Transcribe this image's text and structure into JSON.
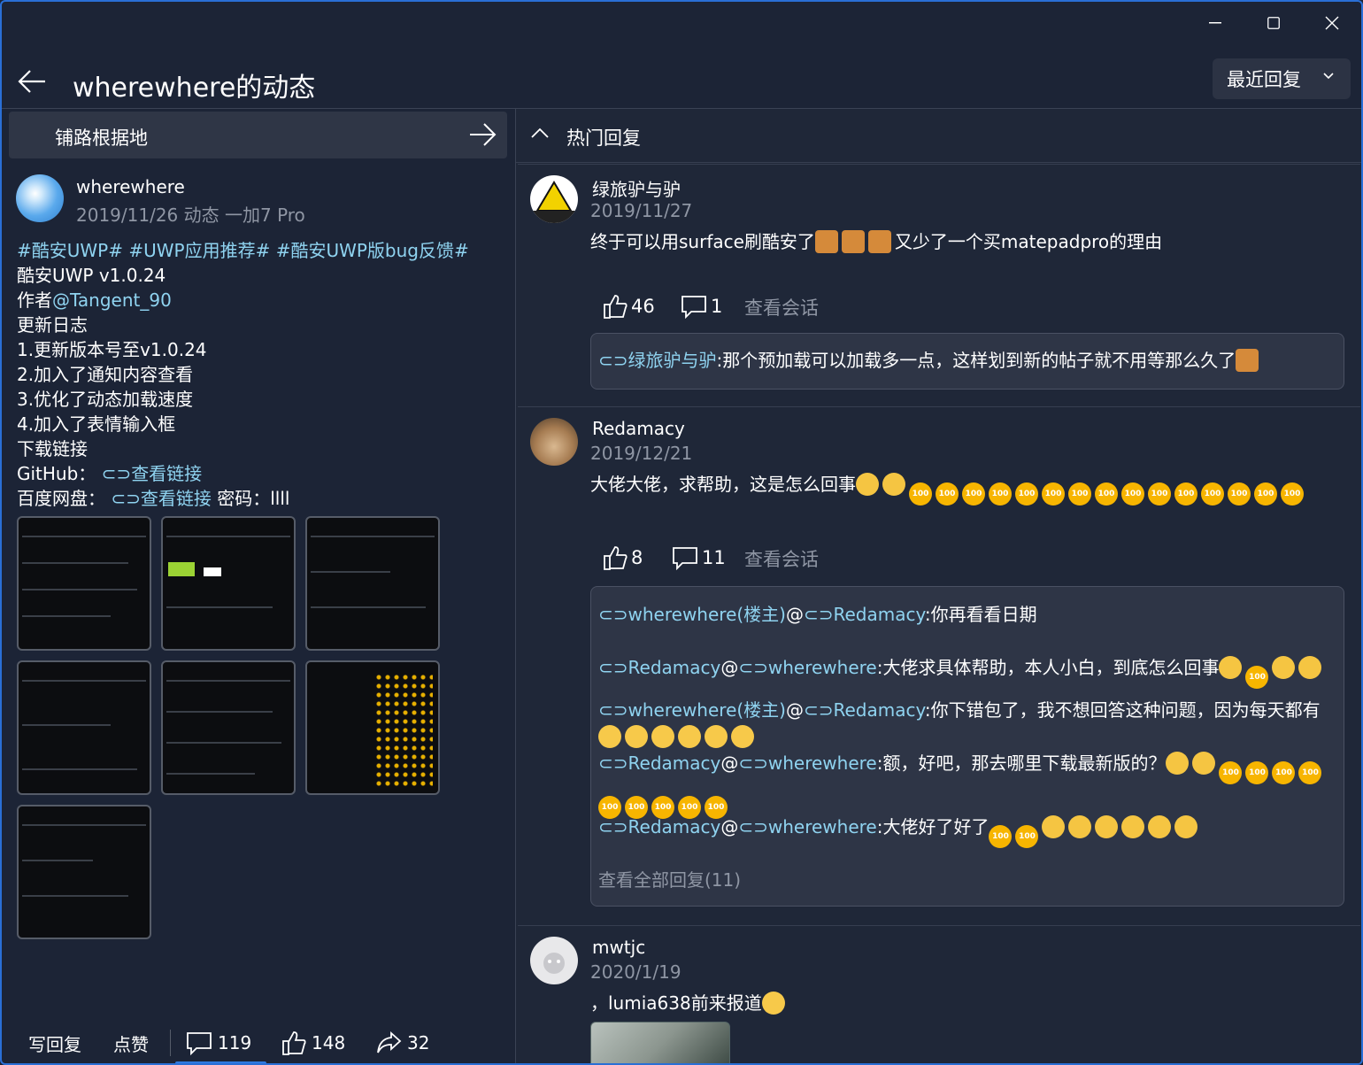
{
  "window": {
    "minimize": "—",
    "maximize": "☐",
    "close": "✕"
  },
  "header": {
    "title": "wherewhere的动态",
    "sort_label": "最近回复"
  },
  "topic": {
    "label": "铺路根据地"
  },
  "post": {
    "author": "wherewhere",
    "meta": "2019/11/26  动态  一加7 Pro",
    "tags": "#酷安UWP# #UWP应用推荐# #酷安UWP版bug反馈#",
    "line1": "酷安UWP v1.0.24",
    "line2_prefix": "作者",
    "line2_mention": "@Tangent_90",
    "line3": "更新日志",
    "line4": "1.更新版本号至v1.0.24",
    "line5": "2.加入了通知内容查看",
    "line6": "3.优化了动态加载速度",
    "line7": "4.加入了表情输入框",
    "line8": "下载链接",
    "line9_prefix": "GitHub：",
    "line9_link": "查看链接",
    "line10_prefix": "百度网盘：",
    "line10_link": "查看链接",
    "line10_suffix": " 密码：llll"
  },
  "bottom": {
    "reply": "写回复",
    "like": "点赞",
    "comments": "119",
    "likes": "148",
    "shares": "32"
  },
  "hot": {
    "label": "热门回复"
  },
  "replies": [
    {
      "user": "绿旅驴与驴",
      "date": "2019/11/27",
      "text": "终于可以用surface刷酷安了",
      "text2": "又少了一个买matepadpro的理由",
      "likes": "46",
      "comments": "1",
      "view": "查看会话",
      "sub": [
        {
          "u1": "绿旅驴与驴",
          "text": ":那个预加载可以加载多一点，这样划到新的帖子就不用等那么久了"
        }
      ]
    },
    {
      "user": "Redamacy",
      "date": "2019/12/21",
      "text": "大佬大佬，求帮助，这是怎么回事",
      "likes": "8",
      "comments": "11",
      "view": "查看会话",
      "sub": [
        {
          "u1": "wherewhere(楼主)",
          "at": "@",
          "u2": "Redamacy",
          "text": ":你再看看日期"
        },
        {
          "u1": "Redamacy",
          "at": "@",
          "u2": "wherewhere",
          "text": ":大佬求具体帮助，本人小白，到底怎么回事"
        },
        {
          "u1": "wherewhere(楼主)",
          "at": "@",
          "u2": "Redamacy",
          "text": ":你下错包了，我不想回答这种问题，因为每天都有"
        },
        {
          "u1": "Redamacy",
          "at": "@",
          "u2": "wherewhere",
          "text": ":额，好吧，那去哪里下载最新版的？"
        },
        {
          "u1": "Redamacy",
          "at": "@",
          "u2": "wherewhere",
          "text": ":大佬好了好了"
        }
      ],
      "more": "查看全部回复(11)"
    },
    {
      "user": "mwtjc",
      "date": "2020/1/19",
      "text": "，lumia638前来报道"
    }
  ],
  "emoji": {
    "hundred": "100"
  },
  "colors": {
    "accent": "#2f7ae0",
    "link": "#8fd3f0",
    "bg": "#1c2436"
  }
}
